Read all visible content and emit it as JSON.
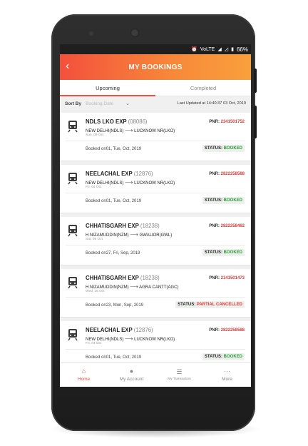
{
  "status_bar": {
    "network": "VoLTE",
    "battery": "66%"
  },
  "header": {
    "title": "MY BOOKINGS",
    "back_icon": "chevron-left-icon"
  },
  "tabs": [
    {
      "label": "Upcoming",
      "active": true
    },
    {
      "label": "Completed",
      "active": false
    }
  ],
  "sort": {
    "label": "Sort By",
    "selected": "Booking Date",
    "last_updated": "Last Updated at 14:40:37 03 Oct, 2019"
  },
  "bookings": [
    {
      "train_name": "NDLS LKO EXP",
      "train_no": "(08086)",
      "from": "NEW DELHI(NDLS)",
      "to": "LUCKNOW NR(LKO)",
      "journey_date": "Sun, 06 Oct",
      "pnr_label": "PNR:",
      "pnr": "2341501752",
      "booked_on": "Booked on01, Tue, Oct, 2019",
      "status_label": "STATUS:",
      "status": "BOOKED",
      "status_type": "booked"
    },
    {
      "train_name": "NEELACHAL EXP",
      "train_no": "(12876)",
      "from": "NEW DELHI(NDLS)",
      "to": "LUCKNOW NR(LKO)",
      "journey_date": "Fri, 04 Oct",
      "pnr_label": "PNR:",
      "pnr": "2822258588",
      "booked_on": "Booked on01, Tue, Oct, 2019",
      "status_label": "STATUS:",
      "status": "BOOKED",
      "status_type": "booked"
    },
    {
      "train_name": "CHHATISGARH EXP",
      "train_no": "(18238)",
      "from": "H NIZAMUDDIN(NZM)",
      "to": "GWALIOR(GWL)",
      "journey_date": "Sat, 05 Oct",
      "pnr_label": "PNR:",
      "pnr": "2822258462",
      "booked_on": "Booked on27, Fri, Sep, 2019",
      "status_label": "STATUS:",
      "status": "BOOKED",
      "status_type": "booked"
    },
    {
      "train_name": "CHHATISGARH EXP",
      "train_no": "(18238)",
      "from": "H NIZAMUDDIN(NZM)",
      "to": "AGRA CANTT(AGC)",
      "journey_date": "Wed, 16 Oct",
      "pnr_label": "PNR:",
      "pnr": "2141501473",
      "booked_on": "Booked on23, Mon, Sep, 2019",
      "status_label": "STATUS:",
      "status": "PARTIAL CANCELLED",
      "status_type": "partial"
    },
    {
      "train_name": "NEELACHAL EXP",
      "train_no": "(12876)",
      "from": "NEW DELHI(NDLS)",
      "to": "LUCKNOW NR(LKO)",
      "journey_date": "Fri, 04 Oct",
      "pnr_label": "PNR:",
      "pnr": "2822258588",
      "booked_on": "Booked on01, Tue, Oct, 2019",
      "status_label": "STATUS:",
      "status": "BOOKED",
      "status_type": "booked"
    }
  ],
  "bottom_nav": [
    {
      "label": "Home",
      "icon": "home-icon",
      "active": true
    },
    {
      "label": "My Account",
      "icon": "user-icon",
      "active": false
    },
    {
      "label": "My Transaction",
      "icon": "list-icon",
      "active": false
    },
    {
      "label": "More",
      "icon": "more-icon",
      "active": false
    }
  ],
  "colors": {
    "accent": "#f4503c",
    "booked": "#2e9b3a",
    "partial": "#e53935",
    "pnr": "#e53935"
  }
}
